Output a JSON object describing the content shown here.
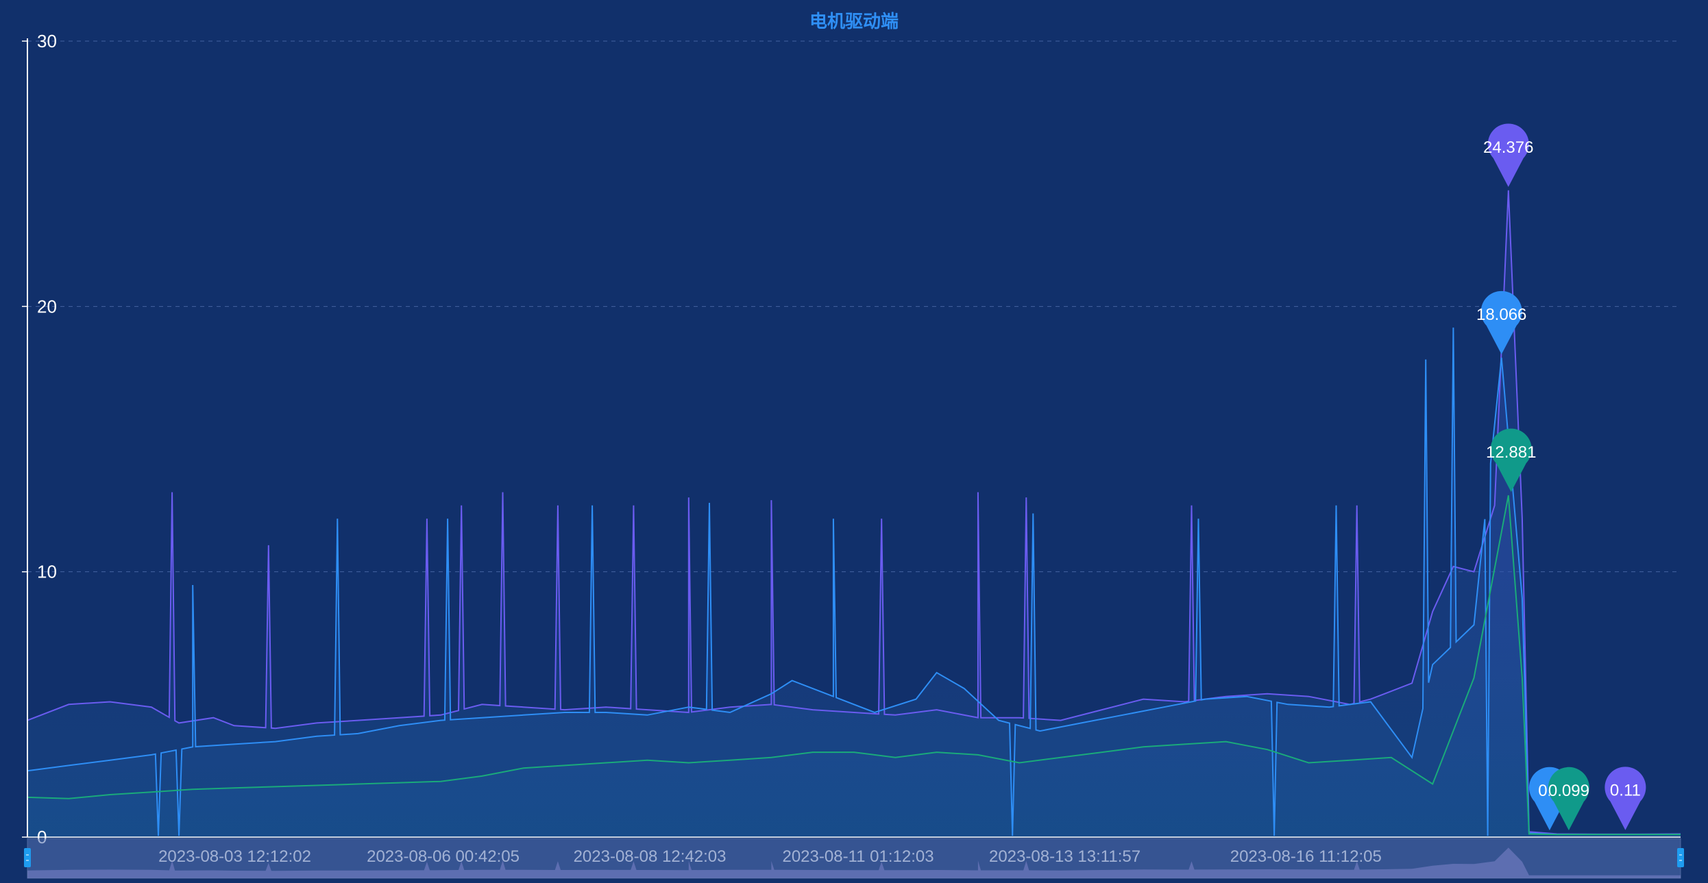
{
  "chart_data": {
    "type": "line",
    "title": "电机驱动端",
    "xlabel": "",
    "ylabel": "",
    "ylim": [
      0,
      30
    ],
    "yticks": [
      "0",
      "10",
      "20",
      "30"
    ],
    "grid": true,
    "x_range": [
      "2023-08-01 00:00:00",
      "2023-08-20 23:59:59"
    ],
    "xtick_labels": [
      {
        "label": "2023-08-03 12:12:02",
        "t": "2023-08-03 12:12:02"
      },
      {
        "label": "2023-08-06 00:42:05",
        "t": "2023-08-06 00:42:05"
      },
      {
        "label": "2023-08-08 12:42:03",
        "t": "2023-08-08 12:42:03"
      },
      {
        "label": "2023-08-11 01:12:03",
        "t": "2023-08-11 01:12:03"
      },
      {
        "label": "2023-08-13 13:11:57",
        "t": "2023-08-13 13:11:57"
      },
      {
        "label": "2023-08-16 11:12:05",
        "t": "2023-08-16 11:12:05"
      }
    ],
    "series": [
      {
        "color": "#6a5cf0",
        "points": [
          [
            "2023-08-01 00:00:00",
            4.4
          ],
          [
            "2023-08-01 12:00:00",
            5.0
          ],
          [
            "2023-08-02 00:00:00",
            5.1
          ],
          [
            "2023-08-02 12:00:00",
            4.9
          ],
          [
            "2023-08-02 20:00:00",
            4.3
          ],
          [
            "2023-08-03 06:00:00",
            4.5
          ],
          [
            "2023-08-03 12:00:00",
            4.2
          ],
          [
            "2023-08-04 00:00:00",
            4.1
          ],
          [
            "2023-08-04 12:00:00",
            4.3
          ],
          [
            "2023-08-05 00:00:00",
            4.4
          ],
          [
            "2023-08-05 12:00:00",
            4.5
          ],
          [
            "2023-08-06 00:00:00",
            4.6
          ],
          [
            "2023-08-06 12:00:00",
            5.0
          ],
          [
            "2023-08-07 00:00:00",
            4.9
          ],
          [
            "2023-08-07 12:00:00",
            4.8
          ],
          [
            "2023-08-08 00:00:00",
            4.9
          ],
          [
            "2023-08-08 12:00:00",
            4.8
          ],
          [
            "2023-08-09 00:00:00",
            4.7
          ],
          [
            "2023-08-09 12:00:00",
            4.9
          ],
          [
            "2023-08-10 00:00:00",
            5.0
          ],
          [
            "2023-08-10 12:00:00",
            4.8
          ],
          [
            "2023-08-11 00:00:00",
            4.7
          ],
          [
            "2023-08-11 12:00:00",
            4.6
          ],
          [
            "2023-08-12 00:00:00",
            4.8
          ],
          [
            "2023-08-12 12:00:00",
            4.5
          ],
          [
            "2023-08-13 00:00:00",
            4.5
          ],
          [
            "2023-08-13 12:00:00",
            4.4
          ],
          [
            "2023-08-14 00:00:00",
            4.8
          ],
          [
            "2023-08-14 12:00:00",
            5.2
          ],
          [
            "2023-08-15 00:00:00",
            5.1
          ],
          [
            "2023-08-15 12:00:00",
            5.3
          ],
          [
            "2023-08-16 00:00:00",
            5.4
          ],
          [
            "2023-08-16 12:00:00",
            5.3
          ],
          [
            "2023-08-17 00:00:00",
            5.0
          ],
          [
            "2023-08-17 06:00:00",
            5.2
          ],
          [
            "2023-08-17 18:00:00",
            5.8
          ],
          [
            "2023-08-18 00:00:00",
            8.5
          ],
          [
            "2023-08-18 06:00:00",
            10.2
          ],
          [
            "2023-08-18 12:00:00",
            10.0
          ],
          [
            "2023-08-18 18:00:00",
            12.5
          ],
          [
            "2023-08-18 22:00:00",
            24.376
          ],
          [
            "2023-08-19 02:00:00",
            12.0
          ],
          [
            "2023-08-19 04:00:00",
            0.2
          ],
          [
            "2023-08-19 12:00:00",
            0.12
          ],
          [
            "2023-08-20 00:00:00",
            0.11
          ],
          [
            "2023-08-20 12:00:00",
            0.11
          ],
          [
            "2023-08-20 23:59:59",
            0.12
          ]
        ],
        "spikes": [
          [
            "2023-08-02 18:00:00",
            13.0
          ],
          [
            "2023-08-03 22:00:00",
            11.0
          ],
          [
            "2023-08-05 20:00:00",
            12.0
          ],
          [
            "2023-08-06 06:00:00",
            12.5
          ],
          [
            "2023-08-06 18:00:00",
            13.0
          ],
          [
            "2023-08-07 10:00:00",
            12.5
          ],
          [
            "2023-08-08 08:00:00",
            12.5
          ],
          [
            "2023-08-09 00:00:00",
            12.8
          ],
          [
            "2023-08-10 00:00:00",
            12.7
          ],
          [
            "2023-08-11 08:00:00",
            12.0
          ],
          [
            "2023-08-12 12:00:00",
            13.0
          ],
          [
            "2023-08-13 02:00:00",
            12.8
          ],
          [
            "2023-08-15 02:00:00",
            12.5
          ],
          [
            "2023-08-17 02:00:00",
            12.5
          ]
        ],
        "peak_label": "24.376",
        "end_label": "0.11"
      },
      {
        "color": "#2e8ef5",
        "points": [
          [
            "2023-08-01 00:00:00",
            2.5
          ],
          [
            "2023-08-01 12:00:00",
            2.7
          ],
          [
            "2023-08-02 00:00:00",
            2.9
          ],
          [
            "2023-08-02 12:00:00",
            3.1
          ],
          [
            "2023-08-03 00:00:00",
            3.4
          ],
          [
            "2023-08-03 12:00:00",
            3.5
          ],
          [
            "2023-08-04 00:00:00",
            3.6
          ],
          [
            "2023-08-04 12:00:00",
            3.8
          ],
          [
            "2023-08-05 00:00:00",
            3.9
          ],
          [
            "2023-08-05 12:00:00",
            4.2
          ],
          [
            "2023-08-06 00:00:00",
            4.4
          ],
          [
            "2023-08-06 12:00:00",
            4.5
          ],
          [
            "2023-08-07 00:00:00",
            4.6
          ],
          [
            "2023-08-07 12:00:00",
            4.7
          ],
          [
            "2023-08-08 00:00:00",
            4.7
          ],
          [
            "2023-08-08 12:00:00",
            4.6
          ],
          [
            "2023-08-09 00:00:00",
            4.9
          ],
          [
            "2023-08-09 12:00:00",
            4.7
          ],
          [
            "2023-08-10 00:00:00",
            5.4
          ],
          [
            "2023-08-10 06:00:00",
            5.9
          ],
          [
            "2023-08-10 18:00:00",
            5.3
          ],
          [
            "2023-08-11 06:00:00",
            4.7
          ],
          [
            "2023-08-11 18:00:00",
            5.2
          ],
          [
            "2023-08-12 00:00:00",
            6.2
          ],
          [
            "2023-08-12 08:00:00",
            5.6
          ],
          [
            "2023-08-12 18:00:00",
            4.4
          ],
          [
            "2023-08-13 06:00:00",
            4.0
          ],
          [
            "2023-08-13 18:00:00",
            4.3
          ],
          [
            "2023-08-14 06:00:00",
            4.6
          ],
          [
            "2023-08-14 18:00:00",
            4.9
          ],
          [
            "2023-08-15 06:00:00",
            5.2
          ],
          [
            "2023-08-15 18:00:00",
            5.3
          ],
          [
            "2023-08-16 06:00:00",
            5.0
          ],
          [
            "2023-08-16 18:00:00",
            4.9
          ],
          [
            "2023-08-17 06:00:00",
            5.1
          ],
          [
            "2023-08-17 18:00:00",
            3.0
          ],
          [
            "2023-08-18 00:00:00",
            6.5
          ],
          [
            "2023-08-18 12:00:00",
            8.0
          ],
          [
            "2023-08-18 20:00:00",
            18.066
          ],
          [
            "2023-08-19 02:00:00",
            9.0
          ],
          [
            "2023-08-19 04:00:00",
            0.15
          ],
          [
            "2023-08-19 12:00:00",
            0.1
          ],
          [
            "2023-08-20 00:00:00",
            0.1
          ],
          [
            "2023-08-20 23:59:59",
            0.1
          ]
        ],
        "spikes": [
          [
            "2023-08-03 00:00:00",
            9.5
          ],
          [
            "2023-08-04 18:00:00",
            12.0
          ],
          [
            "2023-08-06 02:00:00",
            12.0
          ],
          [
            "2023-08-07 20:00:00",
            12.5
          ],
          [
            "2023-08-09 06:00:00",
            12.6
          ],
          [
            "2023-08-10 18:00:00",
            12.0
          ],
          [
            "2023-08-13 04:00:00",
            12.2
          ],
          [
            "2023-08-15 04:00:00",
            12.0
          ],
          [
            "2023-08-16 20:00:00",
            12.5
          ],
          [
            "2023-08-17 22:00:00",
            18.0
          ],
          [
            "2023-08-18 06:00:00",
            19.2
          ]
        ],
        "drops": [
          [
            "2023-08-02 14:00:00"
          ],
          [
            "2023-08-02 20:00:00"
          ],
          [
            "2023-08-12 22:00:00"
          ],
          [
            "2023-08-16 02:00:00"
          ],
          [
            "2023-08-18 16:00:00"
          ]
        ],
        "peak_label": "18.066",
        "end_label": "0.1"
      },
      {
        "color": "#1aaa7a",
        "points": [
          [
            "2023-08-01 00:00:00",
            1.5
          ],
          [
            "2023-08-01 12:00:00",
            1.45
          ],
          [
            "2023-08-02 00:00:00",
            1.6
          ],
          [
            "2023-08-02 12:00:00",
            1.7
          ],
          [
            "2023-08-03 00:00:00",
            1.8
          ],
          [
            "2023-08-03 12:00:00",
            1.85
          ],
          [
            "2023-08-04 00:00:00",
            1.9
          ],
          [
            "2023-08-04 12:00:00",
            1.95
          ],
          [
            "2023-08-05 00:00:00",
            2.0
          ],
          [
            "2023-08-05 12:00:00",
            2.05
          ],
          [
            "2023-08-06 00:00:00",
            2.1
          ],
          [
            "2023-08-06 12:00:00",
            2.3
          ],
          [
            "2023-08-07 00:00:00",
            2.6
          ],
          [
            "2023-08-07 12:00:00",
            2.7
          ],
          [
            "2023-08-08 00:00:00",
            2.8
          ],
          [
            "2023-08-08 12:00:00",
            2.9
          ],
          [
            "2023-08-09 00:00:00",
            2.8
          ],
          [
            "2023-08-09 12:00:00",
            2.9
          ],
          [
            "2023-08-10 00:00:00",
            3.0
          ],
          [
            "2023-08-10 12:00:00",
            3.2
          ],
          [
            "2023-08-11 00:00:00",
            3.2
          ],
          [
            "2023-08-11 12:00:00",
            3.0
          ],
          [
            "2023-08-12 00:00:00",
            3.2
          ],
          [
            "2023-08-12 12:00:00",
            3.1
          ],
          [
            "2023-08-13 00:00:00",
            2.8
          ],
          [
            "2023-08-13 12:00:00",
            3.0
          ],
          [
            "2023-08-14 00:00:00",
            3.2
          ],
          [
            "2023-08-14 12:00:00",
            3.4
          ],
          [
            "2023-08-15 00:00:00",
            3.5
          ],
          [
            "2023-08-15 12:00:00",
            3.6
          ],
          [
            "2023-08-16 00:00:00",
            3.3
          ],
          [
            "2023-08-16 12:00:00",
            2.8
          ],
          [
            "2023-08-17 00:00:00",
            2.9
          ],
          [
            "2023-08-17 12:00:00",
            3.0
          ],
          [
            "2023-08-18 00:00:00",
            2.0
          ],
          [
            "2023-08-18 12:00:00",
            6.0
          ],
          [
            "2023-08-18 22:00:00",
            12.881
          ],
          [
            "2023-08-19 02:00:00",
            6.0
          ],
          [
            "2023-08-19 04:00:00",
            0.12
          ],
          [
            "2023-08-19 12:00:00",
            0.099
          ],
          [
            "2023-08-20 00:00:00",
            0.1
          ],
          [
            "2023-08-20 23:59:59",
            0.1
          ]
        ],
        "peak_label": "12.881",
        "end_label": "0.099"
      }
    ]
  }
}
